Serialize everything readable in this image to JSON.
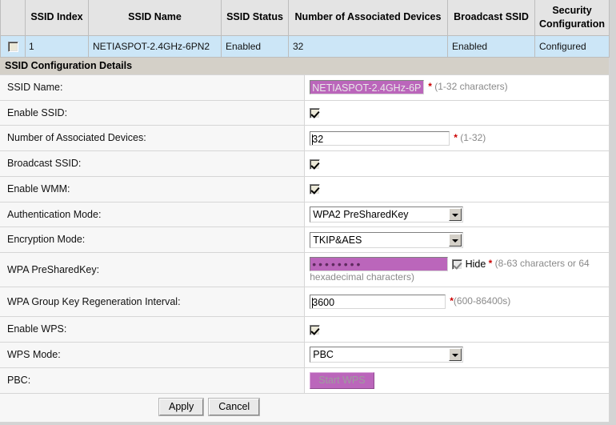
{
  "ssid_table": {
    "columns": [
      "",
      "SSID Index",
      "SSID Name",
      "SSID Status",
      "Number of Associated Devices",
      "Broadcast SSID",
      "Security Configuration"
    ],
    "rows": [
      {
        "selected": false,
        "index": "1",
        "name": "NETIASPOT-2.4GHz-6PN2",
        "status": "Enabled",
        "devices": "32",
        "broadcast": "Enabled",
        "security": "Configured"
      }
    ]
  },
  "details": {
    "section_title": "SSID Configuration Details",
    "ssid_name": {
      "label": "SSID Name:",
      "value": "NETIASPOT-2.4GHz-6P",
      "required": "*",
      "hint": "(1-32 characters)"
    },
    "enable_ssid": {
      "label": "Enable SSID:",
      "checked": true
    },
    "num_devices": {
      "label": "Number of Associated Devices:",
      "value": "32",
      "required": "*",
      "hint": "(1-32)"
    },
    "broadcast_ssid": {
      "label": "Broadcast SSID:",
      "checked": true
    },
    "enable_wmm": {
      "label": "Enable WMM:",
      "checked": true
    },
    "auth_mode": {
      "label": "Authentication Mode:",
      "value": "WPA2 PreSharedKey"
    },
    "encryption_mode": {
      "label": "Encryption Mode:",
      "value": "TKIP&AES"
    },
    "psk": {
      "label": "WPA PreSharedKey:",
      "value": "••••••••",
      "hide_label": "Hide",
      "hide_checked": true,
      "required": "*",
      "hint": "(8-63 characters or 64 hexadecimal characters)"
    },
    "group_key": {
      "label": "WPA Group Key Regeneration Interval:",
      "value": "3600",
      "required": "*",
      "hint": "(600-86400s)"
    },
    "enable_wps": {
      "label": "Enable WPS:",
      "checked": true
    },
    "wps_mode": {
      "label": "WPS Mode:",
      "value": "PBC"
    },
    "pbc": {
      "label": "PBC:",
      "button_label": "Start WPS"
    },
    "apply_label": "Apply",
    "cancel_label": "Cancel"
  },
  "colors": {
    "row_highlight": "#cce6f7",
    "accent_purple": "#bb66bb",
    "section_header": "#d4d0c8",
    "required_red": "#cc0000"
  }
}
